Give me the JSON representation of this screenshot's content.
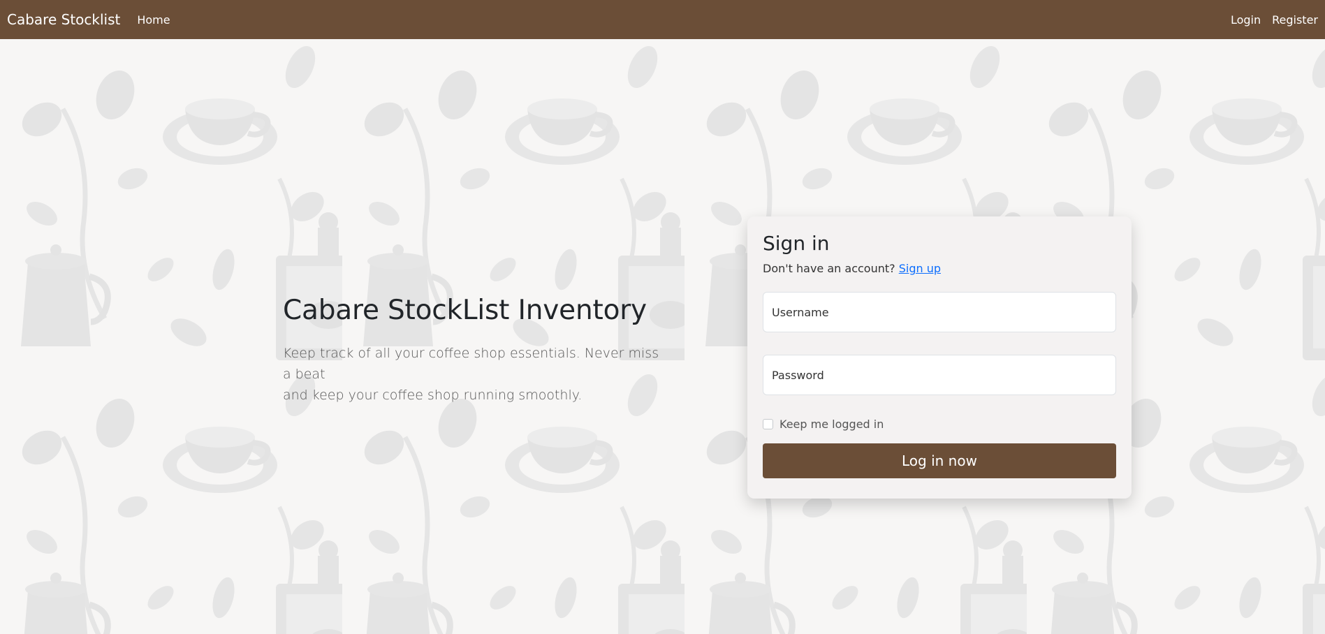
{
  "nav": {
    "brand": "Cabare Stocklist",
    "home": "Home",
    "login": "Login",
    "register": "Register"
  },
  "hero": {
    "title": "Cabare StockList Inventory",
    "subtitle_line1": "Keep track of all your coffee shop essentials. Never miss a beat",
    "subtitle_line2": "and keep your coffee shop running smoothly."
  },
  "signin": {
    "title": "Sign in",
    "prompt": "Don't have an account?",
    "signup_link": "Sign up",
    "username_placeholder": "Username",
    "password_placeholder": "Password",
    "remember_label": "Keep me logged in",
    "submit_label": "Log in now"
  },
  "colors": {
    "brand": "#6b4e37",
    "link": "#0d6efd",
    "pattern": "#e3e3e3"
  }
}
